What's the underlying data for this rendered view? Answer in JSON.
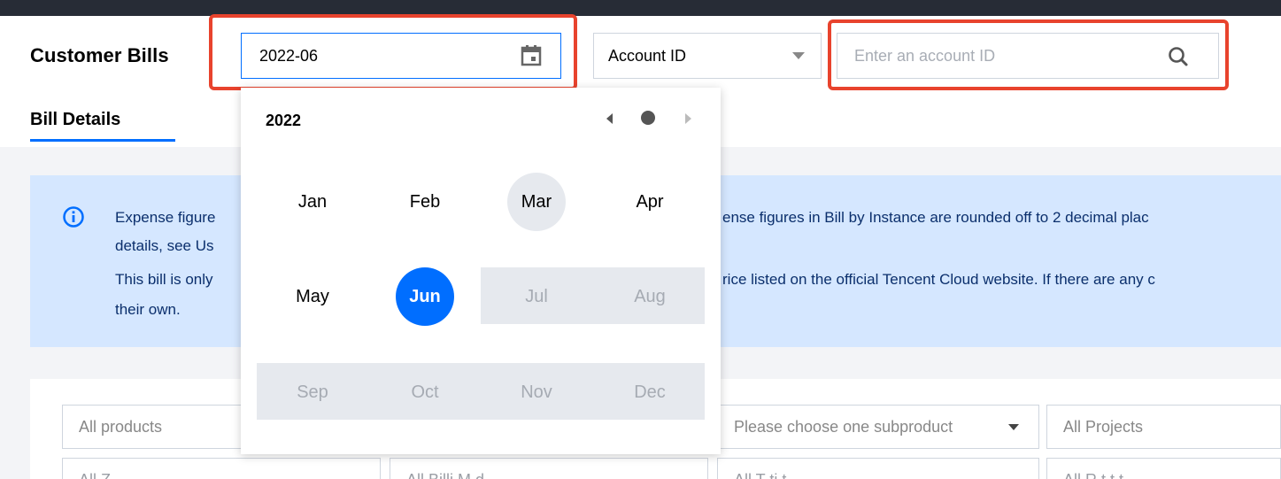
{
  "page_title": "Customer Bills",
  "date_picker": {
    "value": "2022-06"
  },
  "account_select": {
    "value": "Account ID"
  },
  "search": {
    "placeholder": "Enter an account ID"
  },
  "tabs": {
    "bill_details": "Bill Details"
  },
  "info_banner": {
    "line1_left": "Expense figure",
    "line1_right": "ense figures in Bill by Instance are rounded off to 2 decimal plac",
    "line2_left": "details, see Us",
    "line3_left": "This bill is only",
    "line3_right": "rice listed on the official Tencent Cloud website. If there are any c",
    "line4_left": "their own."
  },
  "filters": {
    "products": "All products",
    "subproduct": "Please choose one subproduct",
    "projects": "All Projects",
    "row2_1": "All Z",
    "row2_2": "All Billi  M  d",
    "row2_3": "All T       ti  t",
    "row2_4": "All R          t t  t"
  },
  "month_picker": {
    "year": "2022",
    "months": [
      {
        "label": "Jan",
        "state": "normal"
      },
      {
        "label": "Feb",
        "state": "normal"
      },
      {
        "label": "Mar",
        "state": "hover"
      },
      {
        "label": "Apr",
        "state": "normal"
      },
      {
        "label": "May",
        "state": "normal"
      },
      {
        "label": "Jun",
        "state": "selected"
      },
      {
        "label": "Jul",
        "state": "disabled"
      },
      {
        "label": "Aug",
        "state": "disabled"
      },
      {
        "label": "Sep",
        "state": "disabled"
      },
      {
        "label": "Oct",
        "state": "disabled"
      },
      {
        "label": "Nov",
        "state": "disabled"
      },
      {
        "label": "Dec",
        "state": "disabled"
      }
    ]
  },
  "colors": {
    "accent": "#006eff",
    "highlight": "#e8432d",
    "banner_bg": "#d5e7ff",
    "banner_text": "#0b2f6c"
  }
}
